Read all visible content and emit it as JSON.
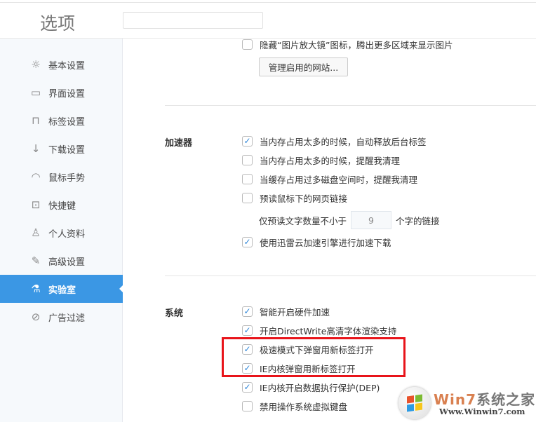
{
  "header": {
    "title": "选项",
    "search_value": ""
  },
  "sidebar": {
    "items": [
      {
        "label": "基本设置",
        "icon": "sun-icon",
        "glyph": "☼"
      },
      {
        "label": "界面设置",
        "icon": "window-icon",
        "glyph": "▭"
      },
      {
        "label": "标签设置",
        "icon": "tab-icon",
        "glyph": "⊓"
      },
      {
        "label": "下载设置",
        "icon": "download-icon",
        "glyph": "↓"
      },
      {
        "label": "鼠标手势",
        "icon": "mouse-icon",
        "glyph": "◠"
      },
      {
        "label": "快捷键",
        "icon": "keyboard-icon",
        "glyph": "⊡"
      },
      {
        "label": "个人资料",
        "icon": "user-icon",
        "glyph": "♙"
      },
      {
        "label": "高级设置",
        "icon": "wrench-icon",
        "glyph": "✎"
      },
      {
        "label": "实验室",
        "icon": "flask-icon",
        "glyph": "⚗",
        "active": true
      },
      {
        "label": "广告过滤",
        "icon": "block-icon",
        "glyph": "⊘"
      }
    ]
  },
  "top": {
    "hide_magnifier": {
      "label": "隐藏“图片放大镜”图标，腾出更多区域来显示图片",
      "checked": false
    },
    "manage_button": "管理启用的网站..."
  },
  "accelerator": {
    "title": "加速器",
    "options": [
      {
        "label": "当内存占用太多的时候，自动释放后台标签",
        "checked": true
      },
      {
        "label": "当内存占用太多的时候，提醒我清理",
        "checked": false
      },
      {
        "label": "当缓存占用过多磁盘空间时，提醒我清理",
        "checked": false
      },
      {
        "label": "预读鼠标下的网页链接",
        "checked": false
      }
    ],
    "prefetch_prefix": "仅预读文字数量不小于",
    "prefetch_value": "9",
    "prefetch_suffix": "个字的链接",
    "xunlei": {
      "label": "使用迅雷云加速引擎进行加速下载",
      "checked": true
    }
  },
  "system": {
    "title": "系统",
    "options": [
      {
        "label": "智能开启硬件加速",
        "checked": true
      },
      {
        "label": "开启DirectWrite高清字体渲染支持",
        "checked": true
      },
      {
        "label": "极速模式下弹窗用新标签打开",
        "checked": true
      },
      {
        "label": "IE内核弹窗用新标签打开",
        "checked": true
      },
      {
        "label": "IE内核开启数据执行保护(DEP)",
        "checked": true
      },
      {
        "label": "禁用操作系统虚拟键盘",
        "checked": false
      }
    ]
  },
  "watermark": {
    "brand_a": "Win7",
    "brand_b": "系统之家",
    "url": "Www.Winwin7.com"
  },
  "colors": {
    "accent": "#3b97e4",
    "highlight": "#e8141a"
  }
}
